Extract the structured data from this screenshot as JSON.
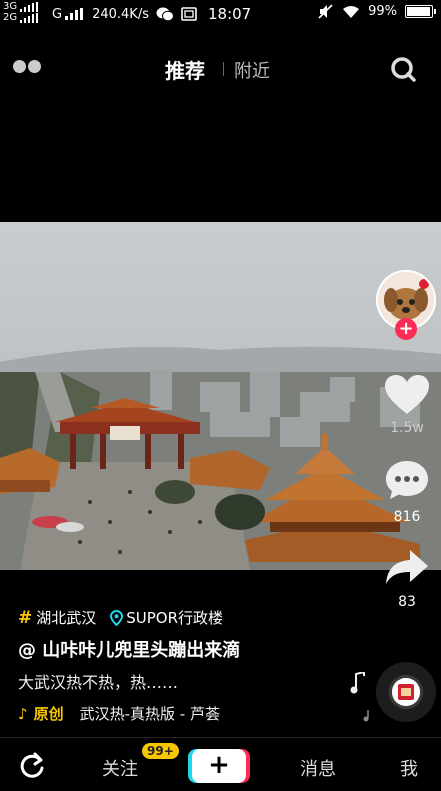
{
  "status_bar": {
    "network_top": "3G",
    "network_bottom": "2G",
    "carrier_g": "G",
    "speed": "240.4K/s",
    "time": "18:07",
    "battery": "99%",
    "battery_level": 0.99
  },
  "top_nav": {
    "tab_recommend": "推荐",
    "tab_nearby": "附近"
  },
  "rail": {
    "likes": "1.5w",
    "comments": "816",
    "shares": "83"
  },
  "caption": {
    "location_tag": "湖北武汉",
    "poi": "SUPOR行政楼",
    "author": "@ 山咔咔儿兜里头蹦出来滴",
    "description": "大武汉热不热，热……",
    "music_label": "原创",
    "music_title": "武汉热-真热版 - 芦荟"
  },
  "bottom_nav": {
    "follow": "关注",
    "follow_badge": "99+",
    "plus": "+",
    "messages": "消息",
    "me": "我"
  },
  "colors": {
    "accent_red": "#fe2c55",
    "accent_cyan": "#20d5ec",
    "accent_yellow": "#f7c600"
  }
}
